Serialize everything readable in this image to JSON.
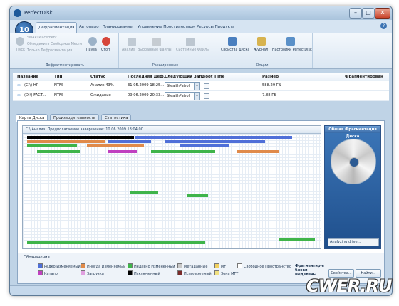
{
  "window": {
    "title": "PerfectDisk"
  },
  "ribbon_tabs": [
    "Дефрагментация",
    "Автопилот Планирование",
    "Управление Пространством",
    "Ресурсы Продукта"
  ],
  "ribbon": {
    "groups": [
      {
        "label": "Дефрагментировать",
        "buttons": [
          "Пуск",
          "SMARTPlacement",
          "Объединить Свободное Место",
          "Только Дефрагментация",
          "Пауза",
          "Стоп"
        ]
      },
      {
        "label": "Расширенные",
        "buttons": [
          "Анализ",
          "Выбранные Файлы",
          "Системные Файлы"
        ]
      },
      {
        "label": "Опции",
        "buttons": [
          "Свойства Диска",
          "Журнал",
          "Настройки PerfectDisk"
        ]
      }
    ]
  },
  "table": {
    "columns": [
      "Название",
      "Тип",
      "Статус",
      "Последняя Деф.",
      "Следующий Зап.",
      "Boot Time",
      "Размер",
      "Фрагментирован"
    ],
    "rows": [
      {
        "name": "(C:\\) HP",
        "type": "NTFS",
        "status": "Анализ 43%",
        "last": "31.05.2009 18:25...",
        "next": "StealthPatrol",
        "size": "588.29 ГБ"
      },
      {
        "name": "(D:\\) FACT...",
        "type": "NTFS",
        "status": "Ожидание",
        "last": "09.06.2009 20:33...",
        "next": "StealthPatrol",
        "size": "7.88 ГБ"
      }
    ]
  },
  "view_tabs": [
    "Карта Диска",
    "Производительность",
    "Статистика"
  ],
  "map": {
    "status": "C:\\ Анализ. Предполагаемое завершение: 10.06.2009 18:04:00"
  },
  "side_panel": {
    "title": "Общая Фрагментация Диска",
    "status": "Analyzing drive..."
  },
  "legend": {
    "title": "Обозначения",
    "items": [
      {
        "label": "Редко Изменяемый",
        "color": "#4f6fd8"
      },
      {
        "label": "Иногда Изменяемый",
        "color": "#e08a4a"
      },
      {
        "label": "Недавно Изменённый",
        "color": "#3fb44a"
      },
      {
        "label": "Метаданные",
        "color": "#c8c8c8"
      },
      {
        "label": "MFT",
        "color": "#f0d060"
      },
      {
        "label": "Свободное Пространство",
        "color": "#ffffff"
      },
      {
        "label": "Каталог",
        "color": "#c040c0"
      },
      {
        "label": "Загрузка",
        "color": "#e0a0e0"
      },
      {
        "label": "Исключенный",
        "color": "#000000"
      },
      {
        "label": "Используемый",
        "color": "#7a2a2a"
      },
      {
        "label": "Зона MFT",
        "color": "#f0e080"
      }
    ],
    "note": "Фрагментир-е блоки выделены",
    "properties_button": "Свойства...",
    "find_button": "Найти..."
  },
  "watermark": "CWER.RU"
}
